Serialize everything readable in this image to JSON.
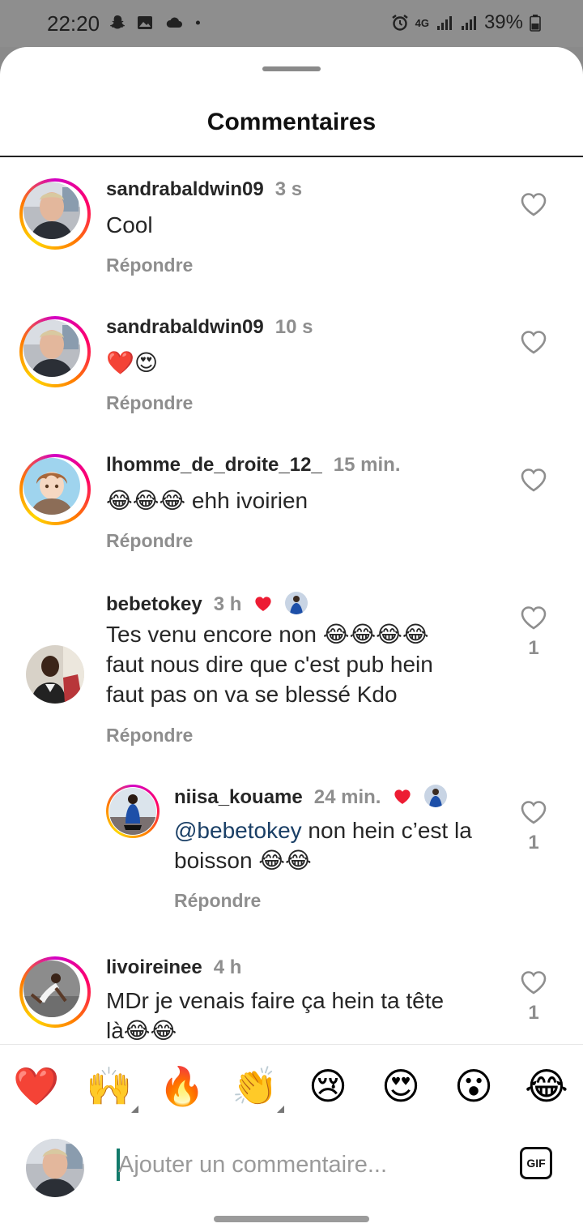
{
  "status_bar": {
    "time": "22:20",
    "left_icons": [
      "snapchat-icon",
      "gallery-icon",
      "cloud-icon",
      "dot-icon"
    ],
    "right_icons": [
      "alarm-icon",
      "4g-icon",
      "signal-icon",
      "signal-icon",
      "battery-icon"
    ],
    "network": "4G",
    "battery": "39%"
  },
  "sheet": {
    "title": "Commentaires"
  },
  "comments": [
    {
      "username": "sandrabaldwin09",
      "time": "3 s",
      "text": "Cool",
      "reply_label": "Répondre",
      "likes": ""
    },
    {
      "username": "sandrabaldwin09",
      "time": "10 s",
      "text": "❤️😍",
      "reply_label": "Répondre",
      "likes": ""
    },
    {
      "username": "lhomme_de_droite_12_",
      "time": "15 min.",
      "text": "😂😂😂 ehh ivoirien",
      "reply_label": "Répondre",
      "likes": ""
    },
    {
      "username": "bebetokey",
      "time": "3 h",
      "author_liked": true,
      "text_lines": [
        "Tes venu encore non 😂😂😂😂",
        "faut nous dire que c'est pub hein",
        "faut pas on va se blessé Kdo"
      ],
      "reply_label": "Répondre",
      "likes": "1"
    },
    {
      "username": "niisa_kouame",
      "time": "24 min.",
      "author_liked": true,
      "mention": "@bebetokey",
      "text_line1": " non hein c’est la",
      "text_line2": "boisson 😂😂",
      "reply_label": "Répondre",
      "likes": "1"
    },
    {
      "username": "livoireinee",
      "time": "4 h",
      "text_lines": [
        "MDr je venais faire ça hein ta tête",
        "là😂😂"
      ],
      "likes": "1"
    }
  ],
  "reactions": [
    {
      "emoji": "❤️",
      "name": "red-heart"
    },
    {
      "emoji": "🙌",
      "name": "raising-hands"
    },
    {
      "emoji": "🔥",
      "name": "fire"
    },
    {
      "emoji": "👏",
      "name": "clapping-hands"
    },
    {
      "emoji": "😢",
      "name": "crying-face"
    },
    {
      "emoji": "😍",
      "name": "heart-eyes"
    },
    {
      "emoji": "😮",
      "name": "surprised-face"
    },
    {
      "emoji": "😂",
      "name": "tears-of-joy"
    }
  ],
  "input": {
    "placeholder": "Ajouter un commentaire...",
    "gif_label": "GIF"
  },
  "colors": {
    "accent_ring": "#d300c5",
    "heart_red": "#ed1c33",
    "mention": "#1a3f66",
    "muted": "#8e8e8e"
  }
}
